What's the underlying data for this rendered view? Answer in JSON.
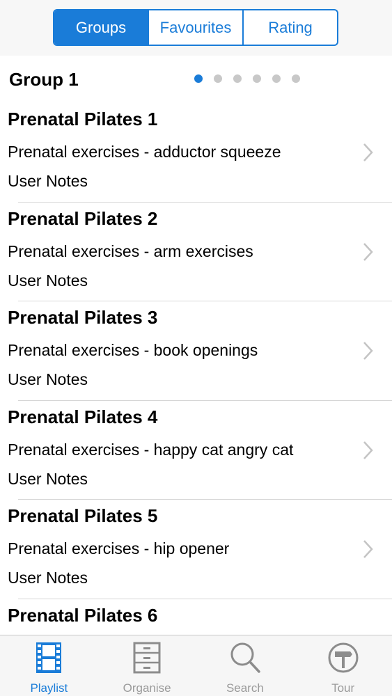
{
  "segments": [
    {
      "label": "Groups",
      "active": true
    },
    {
      "label": "Favourites",
      "active": false
    },
    {
      "label": "Rating",
      "active": false
    }
  ],
  "group": {
    "title": "Group 1",
    "page_count": 6,
    "current_page": 1
  },
  "rows": [
    {
      "title": "Prenatal Pilates 1",
      "subtitle": "Prenatal exercises - adductor squeeze",
      "notes": "User Notes"
    },
    {
      "title": "Prenatal Pilates 2",
      "subtitle": "Prenatal exercises - arm exercises",
      "notes": "User Notes"
    },
    {
      "title": "Prenatal Pilates 3",
      "subtitle": "Prenatal exercises - book openings",
      "notes": "User Notes"
    },
    {
      "title": "Prenatal Pilates 4",
      "subtitle": "Prenatal exercises - happy cat angry cat",
      "notes": "User Notes"
    },
    {
      "title": "Prenatal Pilates 5",
      "subtitle": "Prenatal exercises - hip opener",
      "notes": "User Notes"
    },
    {
      "title": "Prenatal Pilates 6",
      "subtitle": "",
      "notes": ""
    }
  ],
  "tabs": [
    {
      "label": "Playlist",
      "icon": "film-strip-icon",
      "active": true
    },
    {
      "label": "Organise",
      "icon": "cabinet-icon",
      "active": false
    },
    {
      "label": "Search",
      "icon": "magnifier-icon",
      "active": false
    },
    {
      "label": "Tour",
      "icon": "signpost-icon",
      "active": false
    }
  ],
  "colors": {
    "accent": "#1a7cd8",
    "inactive": "#9a9a9a",
    "dot_inactive": "#c8c8c8"
  }
}
